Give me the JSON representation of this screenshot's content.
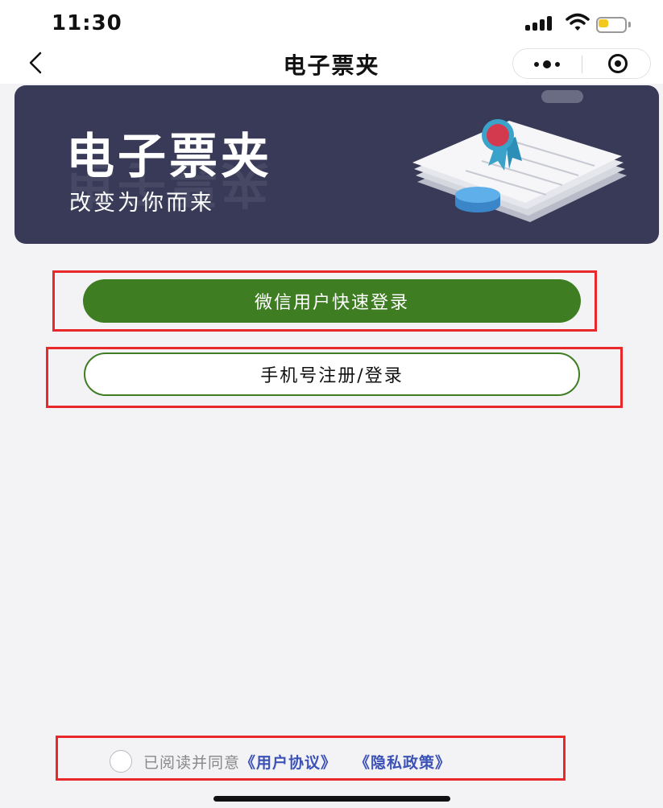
{
  "status_bar": {
    "time": "11:30"
  },
  "nav": {
    "title": "电子票夹",
    "back_icon": "chevron-left-icon",
    "more_icon": "more-dots-icon",
    "close_icon": "target-circle-icon"
  },
  "banner": {
    "title": "电子票夹",
    "slogan": "改变为你而来",
    "background_color": "#383a57"
  },
  "buttons": {
    "wechat_login_label": "微信用户快速登录",
    "phone_login_label": "手机号注册/登录",
    "accent_color": "#3f7d22"
  },
  "agreement": {
    "text": "已阅读并同意",
    "user_agreement_label": "《用户协议》",
    "privacy_policy_label": "《隐私政策》",
    "link_color": "#3c52b6",
    "checked": false
  },
  "annotation_color": "#e8282a"
}
